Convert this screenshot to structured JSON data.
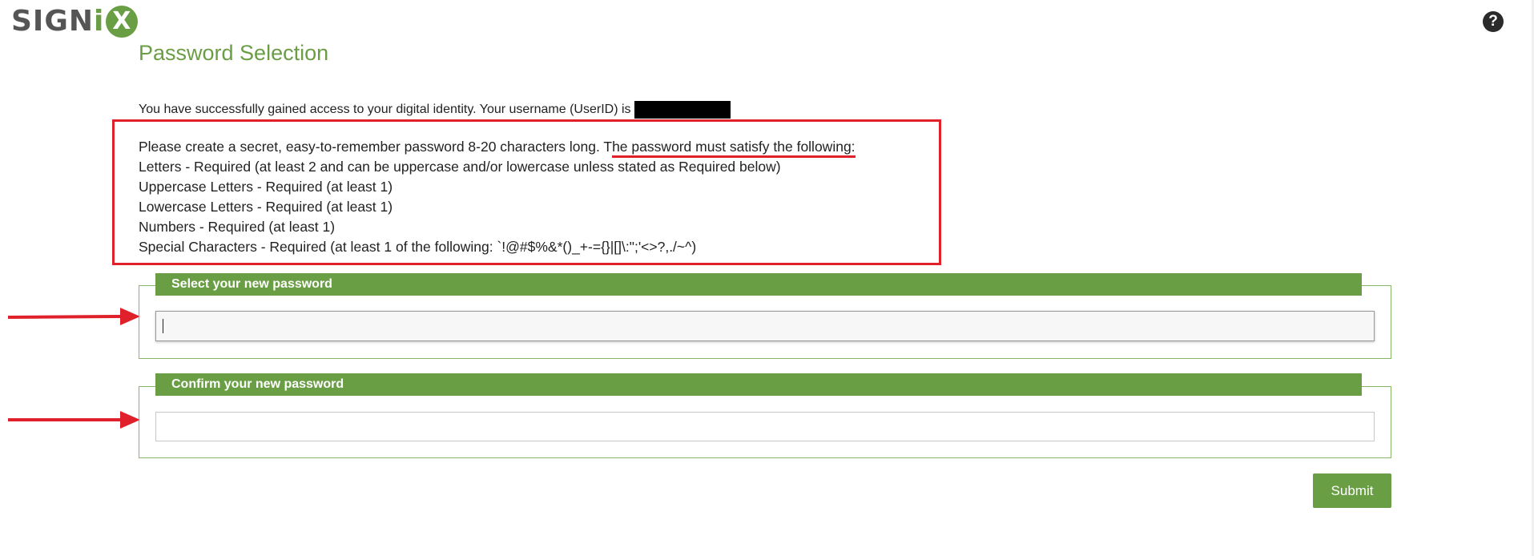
{
  "header": {
    "logo_text": "SIGNiX",
    "logo_prefix": "SIGN",
    "logo_i": "i",
    "logo_x": "X",
    "help_label": "?"
  },
  "page": {
    "title": "Password Selection",
    "intro": "You have successfully gained access to your digital identity. Your username (UserID) is"
  },
  "rules": {
    "lead_prefix": "Please create a secret, easy-to-remember password 8-20 characters long. T",
    "lead_underlined": "he password must satisfy the following:",
    "items": [
      "Letters - Required (at least 2 and can be uppercase and/or lowercase unless stated as Required below)",
      "Uppercase Letters - Required (at least 1)",
      "Lowercase Letters - Required (at least 1)",
      "Numbers - Required (at least 1)",
      "Special Characters - Required (at least 1 of the following: `!@#$%&*()_+-={}|[]\\:\";'<>?,./~^)"
    ]
  },
  "form": {
    "new_password_label": "Select your new password",
    "new_password_value": "",
    "confirm_password_label": "Confirm your new password",
    "confirm_password_value": "",
    "submit_label": "Submit"
  },
  "colors": {
    "brand_green": "#6a9e45",
    "annotation_red": "#e0202a"
  },
  "icons": {
    "help": "question-circle-icon",
    "annotation_arrow": "red-arrow-icon"
  }
}
